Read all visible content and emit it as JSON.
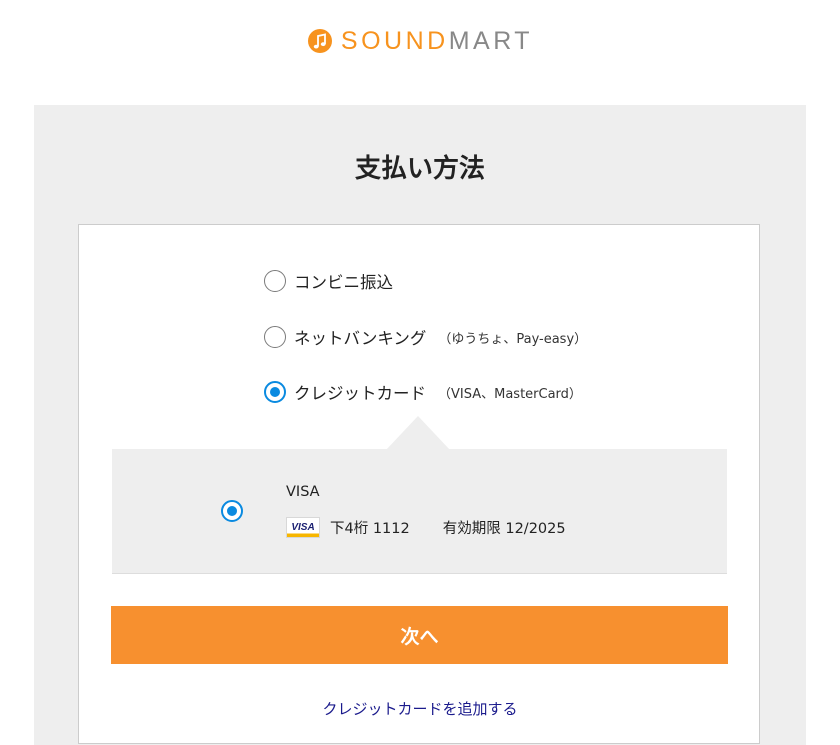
{
  "brand": {
    "logo_text_accent": "SOUND",
    "logo_text_main": "MART",
    "accent_color": "#f7931e",
    "secondary_color": "#888888",
    "logo_icon": "music-note-icon"
  },
  "page": {
    "title": "支払い方法"
  },
  "payment_options": [
    {
      "label": "コンビニ振込",
      "sub": "",
      "selected": false
    },
    {
      "label": "ネットバンキング",
      "sub": "（ゆうちょ、Pay-easy）",
      "selected": false
    },
    {
      "label": "クレジットカード",
      "sub": "（VISA、MasterCard）",
      "selected": true
    }
  ],
  "saved_card": {
    "brand": "VISA",
    "icon": "visa-card-icon",
    "last4": "下4桁 1112",
    "expiry": "有効期限 12/2025",
    "selected": true
  },
  "actions": {
    "next_label": "次へ",
    "next_color": "#f7902f",
    "add_card_label": "クレジットカードを追加する",
    "link_color": "#1a1a8c"
  },
  "colors": {
    "radio_selected": "#0a8ae0",
    "panel_bg": "#eeeeee"
  }
}
